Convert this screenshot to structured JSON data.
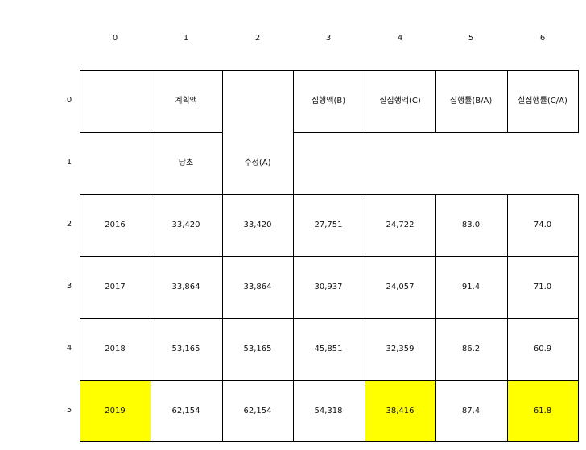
{
  "column_labels": [
    "0",
    "1",
    "2",
    "3",
    "4",
    "5",
    "6"
  ],
  "row_labels": [
    "0",
    "1",
    "2",
    "3",
    "4",
    "5"
  ],
  "highlight_color": "#ffff00",
  "rows": [
    [
      "",
      "계획액",
      "",
      "집행액(B)",
      "실집행액(C)",
      "집행률(B/A)",
      "실집행률(C/A)"
    ],
    [
      "",
      "당초",
      "수정(A)",
      "",
      "",
      "",
      ""
    ],
    [
      "2016",
      "33,420",
      "33,420",
      "27,751",
      "24,722",
      "83.0",
      "74.0"
    ],
    [
      "2017",
      "33,864",
      "33,864",
      "30,937",
      "24,057",
      "91.4",
      "71.0"
    ],
    [
      "2018",
      "53,165",
      "53,165",
      "45,851",
      "32,359",
      "86.2",
      "60.9"
    ],
    [
      "2019",
      "62,154",
      "62,154",
      "54,318",
      "38,416",
      "87.4",
      "61.8"
    ]
  ]
}
